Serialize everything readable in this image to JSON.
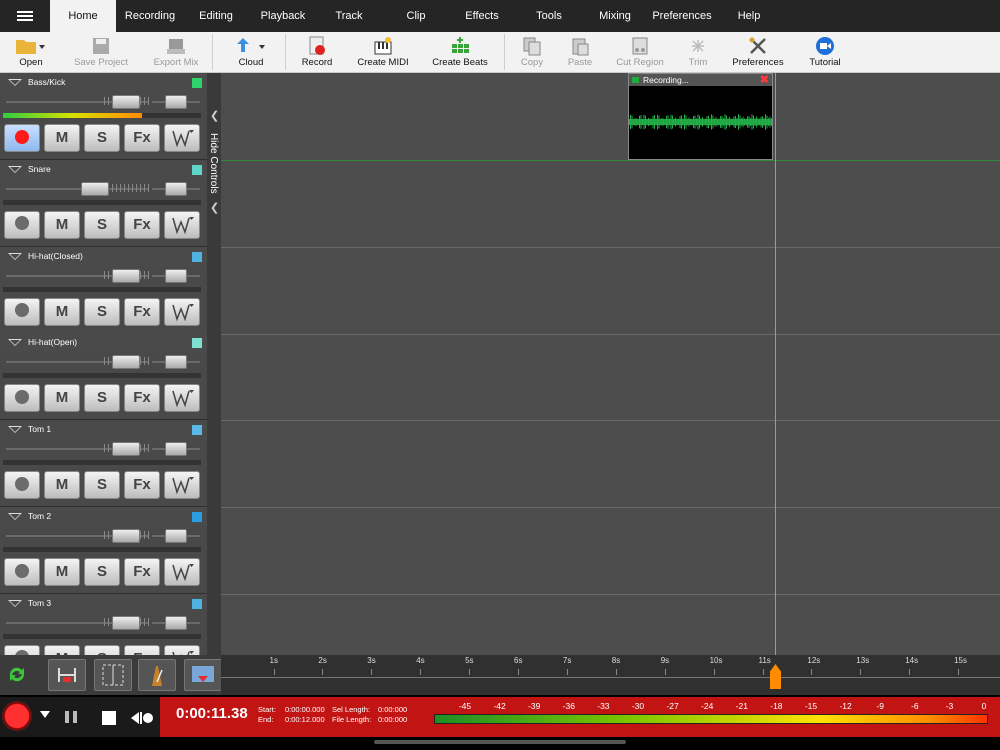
{
  "menu": {
    "tabs": [
      "Home",
      "Recording",
      "Editing",
      "Playback",
      "Track",
      "Clip",
      "Effects",
      "Tools",
      "Mixing",
      "Preferences",
      "Help"
    ],
    "active_tab": "Home"
  },
  "toolbar": {
    "open": "Open",
    "save_project": "Save Project",
    "export_mix": "Export Mix",
    "cloud": "Cloud",
    "record": "Record",
    "create_midi": "Create MIDI",
    "create_beats": "Create Beats",
    "copy": "Copy",
    "paste": "Paste",
    "cut_region": "Cut Region",
    "trim": "Trim",
    "preferences": "Preferences",
    "tutorial": "Tutorial"
  },
  "tracks": [
    {
      "name": "Bass/Kick",
      "color": "#2ed36a",
      "armed": true,
      "level": 0.7
    },
    {
      "name": "Snare",
      "color": "#5fd6c8",
      "armed": false,
      "level": 0
    },
    {
      "name": "Hi-hat(Closed)",
      "color": "#4fb2e0",
      "armed": false,
      "level": 0
    },
    {
      "name": "Hi-hat(Open)",
      "color": "#7fe0d0",
      "armed": false,
      "level": 0
    },
    {
      "name": "Tom 1",
      "color": "#5ab9e6",
      "armed": false,
      "level": 0
    },
    {
      "name": "Tom 2",
      "color": "#2a9ee0",
      "armed": false,
      "level": 0
    },
    {
      "name": "Tom 3",
      "color": "#4fb2e0",
      "armed": false,
      "level": 0
    }
  ],
  "track_buttons": {
    "mute": "M",
    "solo": "S",
    "fx": "Fx"
  },
  "hide_controls": "Hide Controls",
  "clip": {
    "title": "Recording..."
  },
  "ruler": {
    "labels": [
      "1s",
      "2s",
      "3s",
      "4s",
      "5s",
      "6s",
      "7s",
      "8s",
      "9s",
      "10s",
      "11s",
      "12s",
      "13s",
      "14s",
      "15s"
    ]
  },
  "transport": {
    "time": "0:00:11.38",
    "start_label": "Start:",
    "start": "0:00:00.000",
    "end_label": "End:",
    "end": "0:00:12.000",
    "sel_length_label": "Sel Length:",
    "sel_length": "0:00:000",
    "file_length_label": "File Length:",
    "file_length": "0:00:000"
  },
  "vu": {
    "labels": [
      "-45",
      "-42",
      "-39",
      "-36",
      "-33",
      "-30",
      "-27",
      "-24",
      "-21",
      "-18",
      "-15",
      "-12",
      "-9",
      "-6",
      "-3",
      "0"
    ]
  }
}
